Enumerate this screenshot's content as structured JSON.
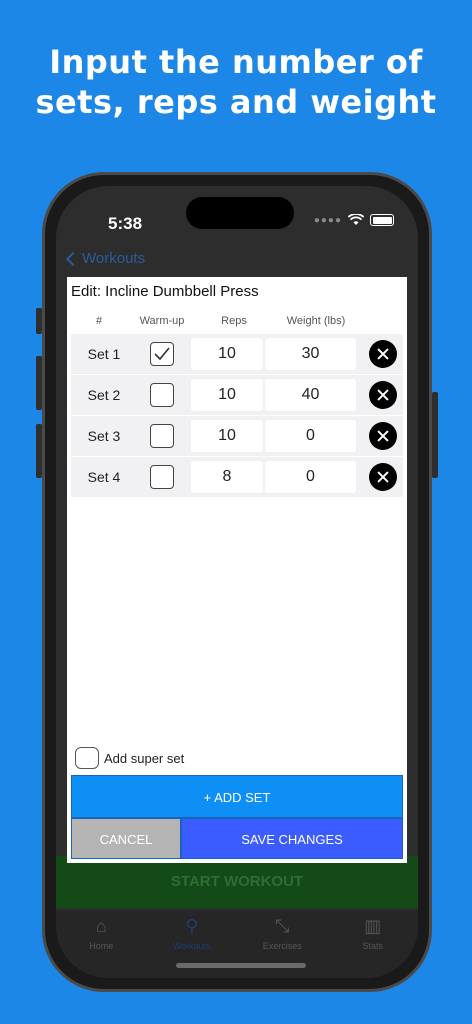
{
  "headline": [
    "Input the number of",
    "sets, reps and weight"
  ],
  "status": {
    "time": "5:38"
  },
  "nav": {
    "back_label": "Workouts"
  },
  "background": {
    "start_button": "START WORKOUT"
  },
  "tabs": [
    {
      "label": "Home",
      "icon": "house-icon"
    },
    {
      "label": "Workouts",
      "icon": "weightlifter-icon"
    },
    {
      "label": "Exercises",
      "icon": "dumbbell-icon"
    },
    {
      "label": "Stats",
      "icon": "chart-icon"
    }
  ],
  "modal": {
    "title": "Edit: Incline Dumbbell Press",
    "columns": {
      "num": "#",
      "warmup": "Warm-up",
      "reps": "Reps",
      "weight": "Weight (lbs)"
    },
    "sets": [
      {
        "label": "Set 1",
        "warmup": true,
        "reps": "10",
        "weight": "30"
      },
      {
        "label": "Set 2",
        "warmup": false,
        "reps": "10",
        "weight": "40"
      },
      {
        "label": "Set 3",
        "warmup": false,
        "reps": "10",
        "weight": "0"
      },
      {
        "label": "Set 4",
        "warmup": false,
        "reps": "8",
        "weight": "0"
      }
    ],
    "super_set_label": "Add super set",
    "add_set_label": "+ ADD SET",
    "cancel_label": "CANCEL",
    "save_label": "SAVE CHANGES"
  },
  "colors": {
    "page_bg": "#1c87e6",
    "add_set": "#0d8ff5",
    "save": "#3b5cff",
    "cancel": "#b4b4b4"
  }
}
